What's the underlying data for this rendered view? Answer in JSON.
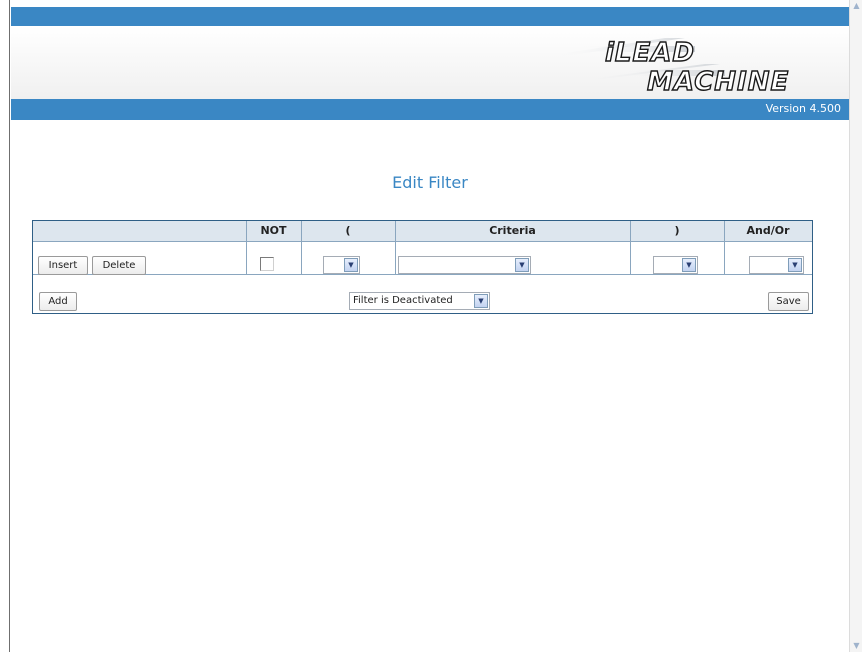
{
  "header": {
    "logo_line1": "iLEAD",
    "logo_line2": "MACHINE",
    "version": "Version 4.500"
  },
  "page_title": "Edit Filter",
  "table": {
    "columns": [
      "",
      "NOT",
      "(",
      "Criteria",
      ")",
      "And/Or"
    ],
    "row": {
      "insert_label": "Insert",
      "delete_label": "Delete",
      "not_checked": false,
      "open_paren_value": "",
      "criteria_value": "",
      "close_paren_value": "",
      "and_or_value": ""
    }
  },
  "footer": {
    "add_label": "Add",
    "status_select_value": "Filter is Deactivated",
    "save_label": "Save"
  },
  "colors": {
    "brand_blue": "#3a87c4",
    "header_row_bg": "#dde6ee",
    "border": "#2f5f86"
  }
}
